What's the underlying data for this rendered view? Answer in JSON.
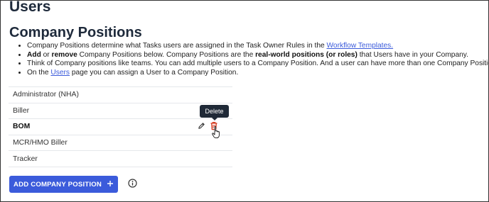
{
  "header": {
    "title": "Users",
    "section_title": "Company Positions"
  },
  "bullets": {
    "b1_text": "Company Positions determine what Tasks users are assigned in the Task Owner Rules in the ",
    "b1_link": "Workflow Templates.",
    "b2_add": "Add",
    "b2_or": " or ",
    "b2_remove": "remove",
    "b2_mid": " Company Positions below. Company Positions are the ",
    "b2_strong": "real-world positions (or roles)",
    "b2_end": " that Users have in your Company.",
    "b3_text": "Think of Company positions like teams. You can add multiple users to a Company Position. And a user can have more than one Company Position.",
    "b4_pre": "On the ",
    "b4_link": "Users",
    "b4_post": " page you can assign a User to a Company Position."
  },
  "positions": [
    "Administrator (NHA)",
    "Biller",
    "BOM",
    "MCR/HMO Biller",
    "Tracker"
  ],
  "tooltip": {
    "text": "Delete"
  },
  "add_button": {
    "label": "ADD COMPANY POSITION",
    "icon": "plus-icon"
  },
  "colors": {
    "accent": "#3b5bdb",
    "delete_icon": "#d63a1e",
    "title": "#1e2a3b"
  }
}
